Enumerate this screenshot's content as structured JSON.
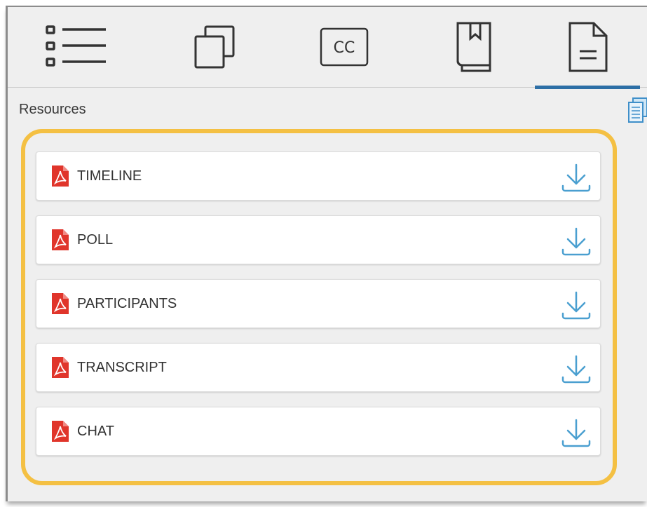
{
  "tabs": [
    {
      "icon": "list-icon",
      "active": false
    },
    {
      "icon": "slides-icon",
      "active": false
    },
    {
      "icon": "closed-captions-icon",
      "label": "CC",
      "active": false
    },
    {
      "icon": "bookmark-book-icon",
      "active": false
    },
    {
      "icon": "document-icon",
      "active": true
    }
  ],
  "resources": {
    "title": "Resources",
    "copy_icon": "copy-icon",
    "items": [
      {
        "label": "TIMELINE",
        "icon": "pdf-icon",
        "action_icon": "download-icon"
      },
      {
        "label": "POLL",
        "icon": "pdf-icon",
        "action_icon": "download-icon"
      },
      {
        "label": "PARTICIPANTS",
        "icon": "pdf-icon",
        "action_icon": "download-icon"
      },
      {
        "label": "TRANSCRIPT",
        "icon": "pdf-icon",
        "action_icon": "download-icon"
      },
      {
        "label": "CHAT",
        "icon": "pdf-icon",
        "action_icon": "download-icon"
      }
    ]
  },
  "colors": {
    "panel_bg": "#efefef",
    "highlight": "#f4c043",
    "active_tab_underline": "#2d6fa6",
    "pdf_red": "#e0352b",
    "download_blue": "#4a9fd0"
  }
}
